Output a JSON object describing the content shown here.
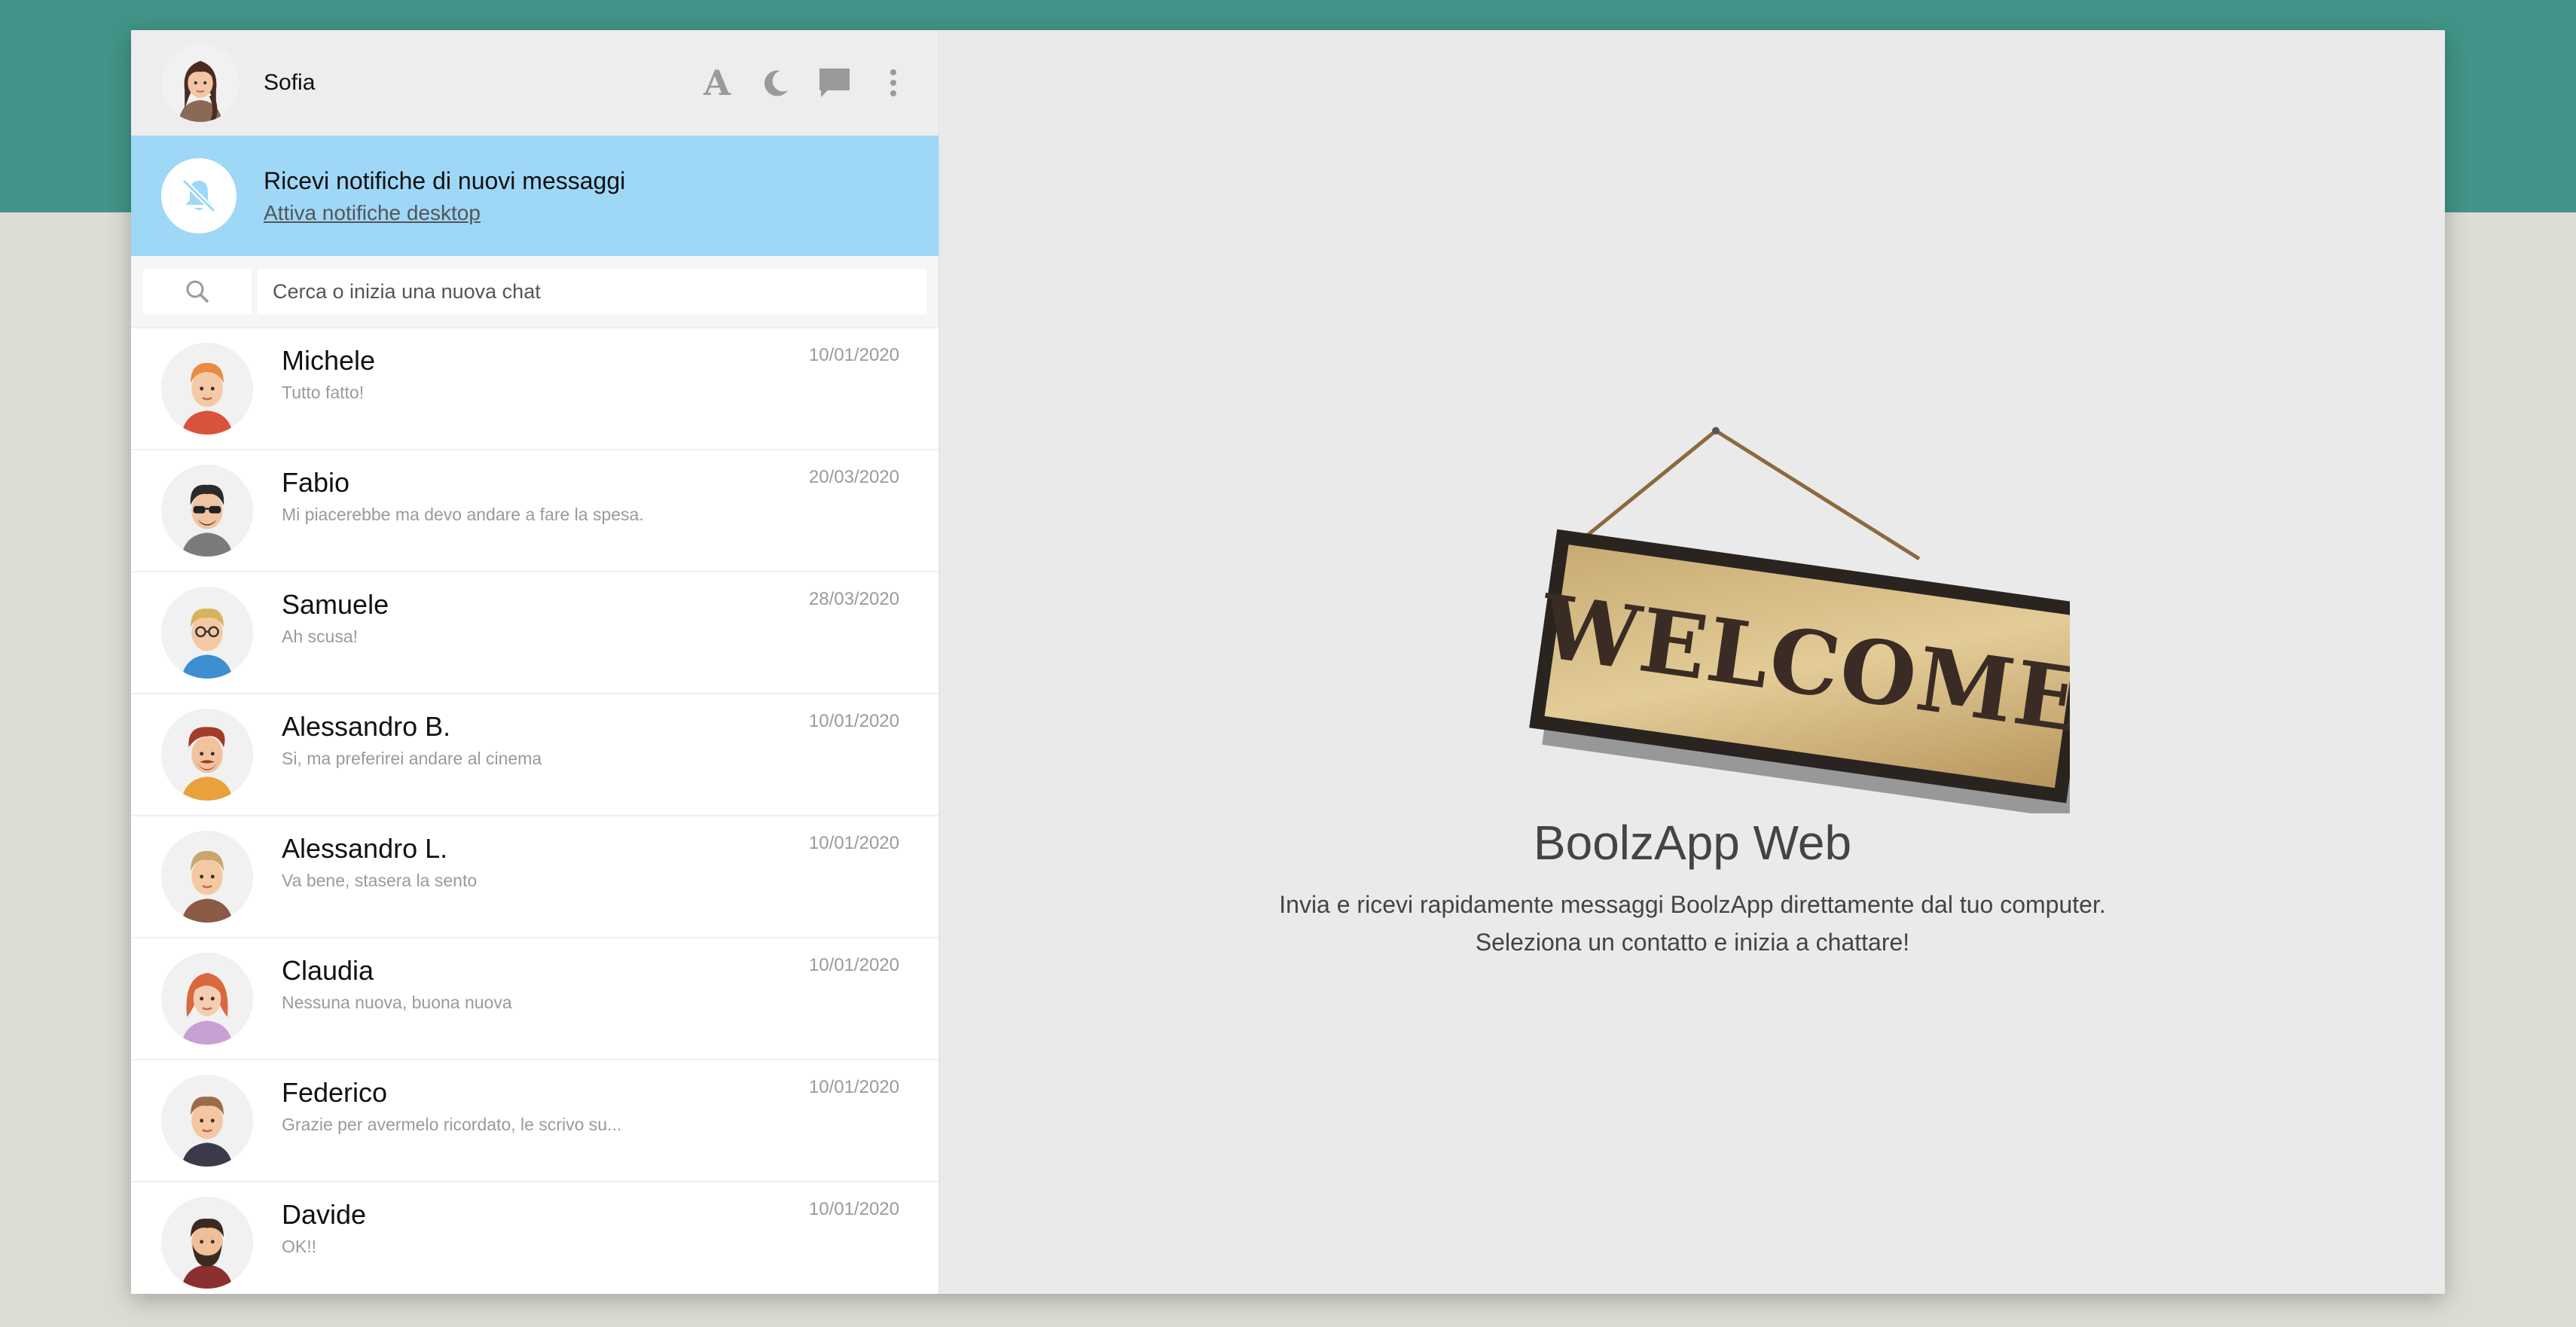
{
  "user": {
    "name": "Sofia",
    "avatar": "avatar-sofia"
  },
  "header_icons": [
    "font-size-icon",
    "moon-icon",
    "chat-icon",
    "more-vertical-icon"
  ],
  "header_font_glyph": "A",
  "notifications": {
    "title": "Ricevi notifiche di nuovi messaggi",
    "link": "Attiva notifiche desktop",
    "icon": "bell-off-icon"
  },
  "search": {
    "placeholder": "Cerca o inizia una nuova chat",
    "icon": "search-icon"
  },
  "contacts": [
    {
      "name": "Michele",
      "last": "Tutto fatto!",
      "date": "10/01/2020"
    },
    {
      "name": "Fabio",
      "last": "Mi piacerebbe ma devo andare a fare la spesa.",
      "date": "20/03/2020"
    },
    {
      "name": "Samuele",
      "last": "Ah scusa!",
      "date": "28/03/2020"
    },
    {
      "name": "Alessandro B.",
      "last": "Si, ma preferirei andare al cinema",
      "date": "10/01/2020"
    },
    {
      "name": "Alessandro L.",
      "last": "Va bene, stasera la sento",
      "date": "10/01/2020"
    },
    {
      "name": "Claudia",
      "last": "Nessuna nuova, buona nuova",
      "date": "10/01/2020"
    },
    {
      "name": "Federico",
      "last": "Grazie per avermelo ricordato, le scrivo su...",
      "date": "10/01/2020"
    },
    {
      "name": "Davide",
      "last": "OK!!",
      "date": "10/01/2020"
    }
  ],
  "welcome": {
    "sign_text": "WELCOME",
    "title": "BoolzApp Web",
    "subtitle_line1": "Invia e ricevi rapidamente messaggi BoolzApp direttamente dal tuo computer.",
    "subtitle_line2": "Seleziona un contatto e inizia a chattare!"
  },
  "colors": {
    "top_band": "#419487",
    "notify_bar": "#9fd7f7",
    "app_bg": "#eaeaea",
    "page_bg": "#dcdcd4"
  }
}
